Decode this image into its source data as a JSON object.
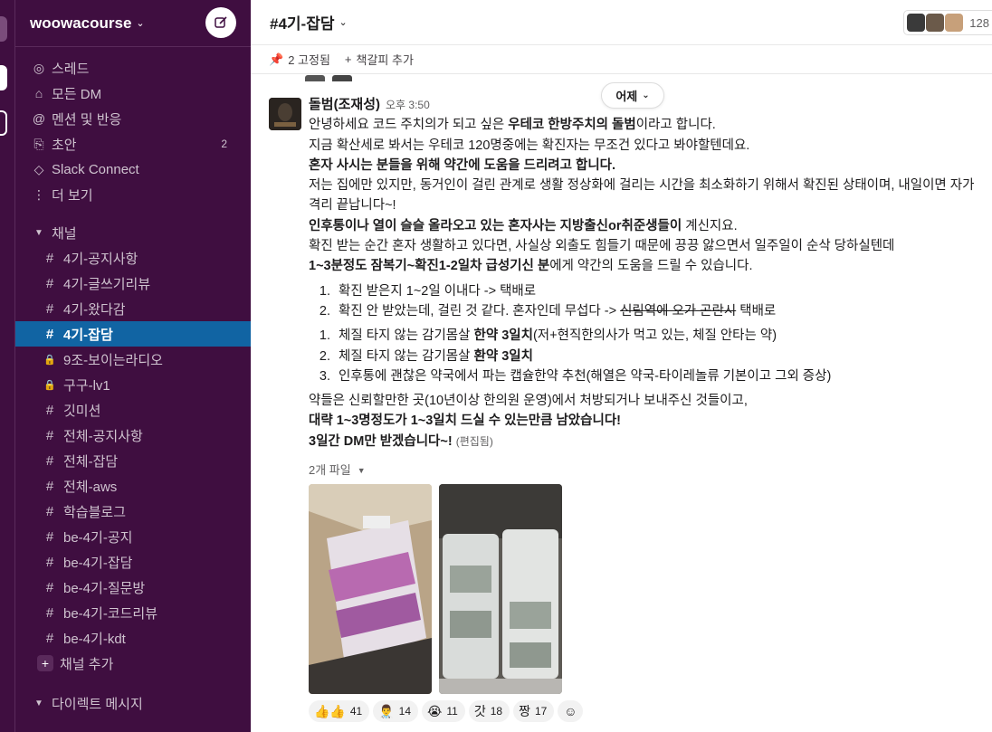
{
  "workspace": {
    "name": "woowacourse"
  },
  "nav": [
    {
      "icon": "threads-icon",
      "glyph": "◎",
      "label": "스레드"
    },
    {
      "icon": "dm-icon",
      "glyph": "⌂",
      "label": "모든 DM"
    },
    {
      "icon": "mention-icon",
      "glyph": "@",
      "label": "멘션 및 반응"
    },
    {
      "icon": "drafts-icon",
      "glyph": "⎘",
      "label": "초안",
      "badge": "2"
    },
    {
      "icon": "slack-connect-icon",
      "glyph": "◇",
      "label": "Slack Connect"
    },
    {
      "icon": "more-icon",
      "glyph": "⋮",
      "label": "더 보기"
    }
  ],
  "channels_section": {
    "label": "채널"
  },
  "channels": [
    {
      "label": "4기-공지사항",
      "type": "public"
    },
    {
      "label": "4기-글쓰기리뷰",
      "type": "public"
    },
    {
      "label": "4기-왔다감",
      "type": "public"
    },
    {
      "label": "4기-잡담",
      "type": "public",
      "active": true
    },
    {
      "label": "9조-보이는라디오",
      "type": "private"
    },
    {
      "label": "구구-lv1",
      "type": "private"
    },
    {
      "label": "깃미션",
      "type": "public"
    },
    {
      "label": "전체-공지사항",
      "type": "public"
    },
    {
      "label": "전체-잡담",
      "type": "public"
    },
    {
      "label": "전체-aws",
      "type": "public"
    },
    {
      "label": "학습블로그",
      "type": "public"
    },
    {
      "label": "be-4기-공지",
      "type": "public"
    },
    {
      "label": "be-4기-잡담",
      "type": "public"
    },
    {
      "label": "be-4기-질문방",
      "type": "public"
    },
    {
      "label": "be-4기-코드리뷰",
      "type": "public"
    },
    {
      "label": "be-4기-kdt",
      "type": "public"
    }
  ],
  "add_channel_label": "채널 추가",
  "dm_section": {
    "label": "다이렉트 메시지"
  },
  "channel_header": {
    "title": "#4기-잡담",
    "member_count": "128"
  },
  "bookmarks": {
    "pinned": "2 고정됨",
    "add": "책갈피 추가"
  },
  "date_divider": "어제",
  "message": {
    "author": "돌범(조재성)",
    "time": "오후 3:50",
    "p1_pre": "안녕하세요 코드 주치의가 되고 싶은 ",
    "p1_bold": "우테코 한방주치의 돌범",
    "p1_post": "이라고 합니다.",
    "p2": "지금 확산세로 봐서는 우테코 120명중에는 확진자는 무조건 있다고 봐야할텐데요.",
    "p3": "혼자 사시는 분들을 위해 약간에 도움을 드리려고 합니다.",
    "p4": "저는 집에만 있지만, 동거인이 걸린 관계로 생활 정상화에 걸리는 시간을 최소화하기 위해서 확진된 상태이며, 내일이면 자가",
    "p5": "격리 끝납니다~!",
    "p6_bold1": "인후통이나 열이 슬슬 올라오고 있는 혼자사는  지방출신or취준생들이",
    "p6_post": " 계신지요.",
    "p7": "확진 받는 순간 혼자 생활하고 있다면, 사실상 외출도 힘들기 때문에  끙끙 앓으면서 일주일이 순삭 당하실텐데",
    "p8_bold1": "1~3분정도  잠복기~확진1-2일차 급성기신 분",
    "p8_post": "에게 약간의 도움을 드릴 수 있습니다.",
    "list1": [
      {
        "text": "확진 받은지 1~2일 이내다 -> 택배로"
      },
      {
        "pre": "확진 안 받았는데, 걸린 것 같다. 혼자인데 무섭다 -> ",
        "strike": "신림역에 오가 곤란시",
        "post": " 택배로"
      }
    ],
    "list2": [
      {
        "pre": "체질 타지 않는 감기몸살 ",
        "bold": "한약 3일치",
        "post": "(저+현직한의사가 먹고 있는, 체질 안타는 약)"
      },
      {
        "pre": "체질 타지 않는 감기몸살 ",
        "bold": "환약 3일치",
        "post": ""
      },
      {
        "pre": "인후통에 괜찮은 약국에서 파는 캡슐한약 추천(해열은 약국-타이레놀류 기본이고 그외 증상)",
        "bold": "",
        "post": ""
      }
    ],
    "p9": "약들은 신뢰할만한 곳(10년이상 한의원 운영)에서 처방되거나 보내주신 것들이고,",
    "p10": "대략 1~3명정도가 1~3일치 드실 수 있는만큼 남았습니다!",
    "p11": "3일간 DM만 받겠습니다~!",
    "edited": "(편집됨)",
    "files_label": "2개 파일",
    "reactions": [
      {
        "emoji": "👍👍",
        "count": "41"
      },
      {
        "emoji": "👨‍⚕️",
        "count": "14"
      },
      {
        "emoji": "😭",
        "count": "11"
      },
      {
        "emoji": "갓",
        "count": "18"
      },
      {
        "emoji": "짱",
        "count": "17"
      }
    ]
  }
}
